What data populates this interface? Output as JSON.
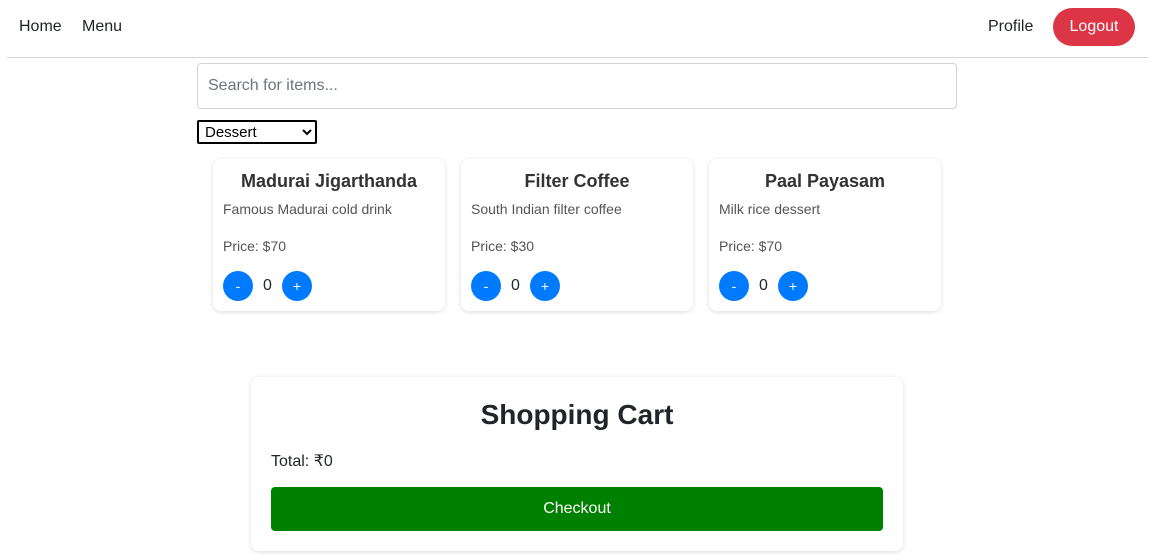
{
  "navbar": {
    "home_label": "Home",
    "menu_label": "Menu",
    "profile_label": "Profile",
    "logout_label": "Logout"
  },
  "search": {
    "placeholder": "Search for items...",
    "value": ""
  },
  "category_filter": {
    "selected": "Dessert"
  },
  "items": [
    {
      "name": "Madurai Jigarthanda",
      "description": "Famous Madurai cold drink",
      "price": "Price: $70",
      "minus_label": "-",
      "plus_label": "+",
      "quantity": "0"
    },
    {
      "name": "Filter Coffee",
      "description": "South Indian filter coffee",
      "price": "Price: $30",
      "minus_label": "-",
      "plus_label": "+",
      "quantity": "0"
    },
    {
      "name": "Paal Payasam",
      "description": "Milk rice dessert",
      "price": "Price: $70",
      "minus_label": "-",
      "plus_label": "+",
      "quantity": "0"
    }
  ],
  "cart": {
    "title": "Shopping Cart",
    "total": "Total: ₹0",
    "checkout_label": "Checkout"
  },
  "colors": {
    "logout": "#dc3545",
    "qty_button": "#007bff",
    "checkout": "#008000"
  }
}
